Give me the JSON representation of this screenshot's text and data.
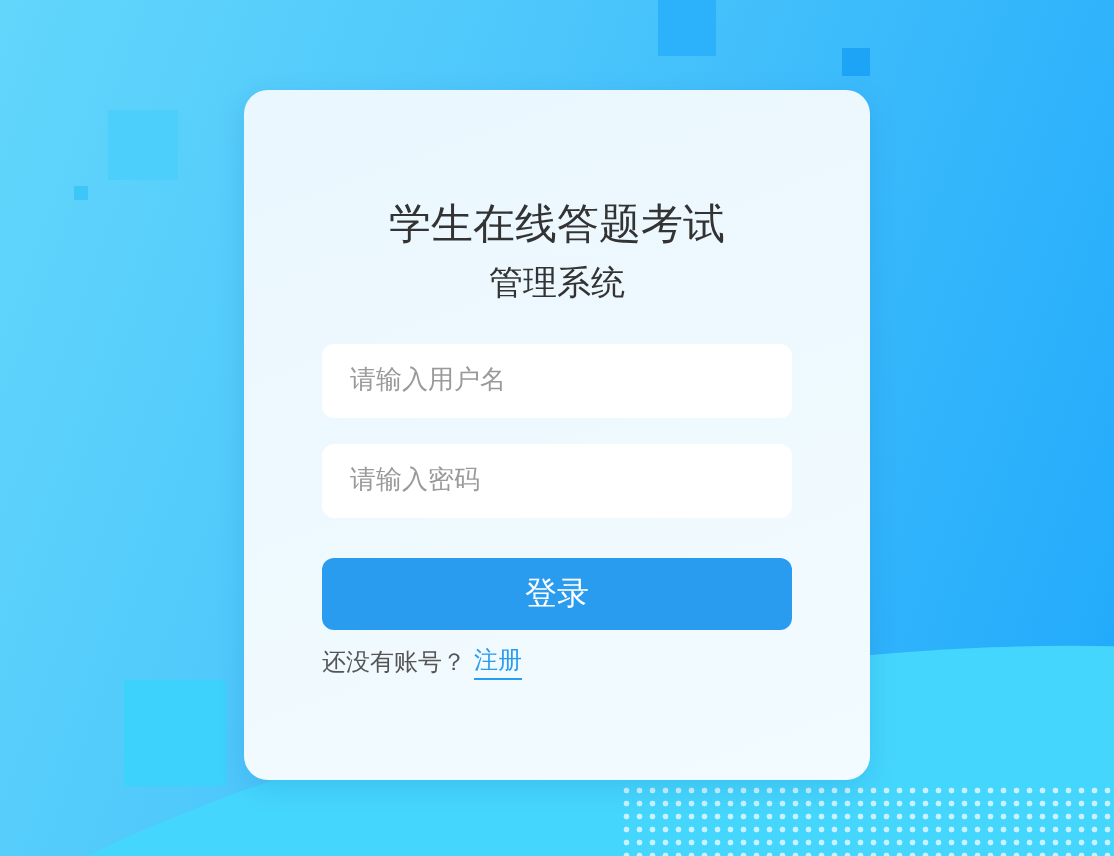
{
  "title": {
    "line_1": "学生在线答题考试",
    "line_2": "管理系统"
  },
  "fields": [
    {
      "placeholder": "请输入用户名"
    },
    {
      "placeholder": "请输入密码"
    }
  ],
  "login_button": "登录",
  "register_prompt": {
    "text": "还没有账号？",
    "link": "注册"
  }
}
